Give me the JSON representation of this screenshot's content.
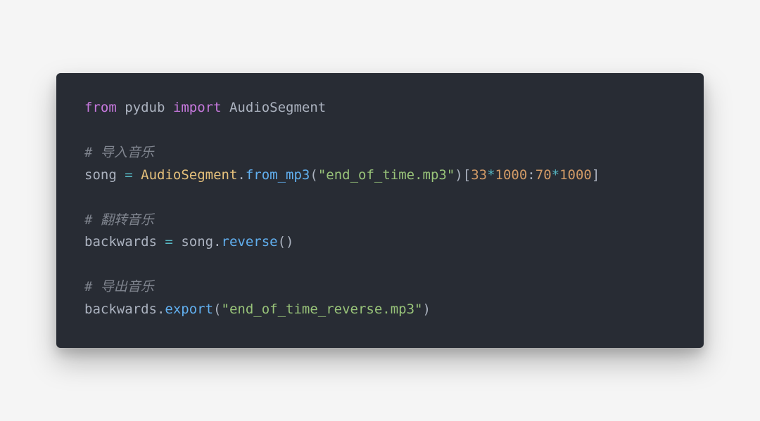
{
  "code": {
    "tokens": [
      [
        {
          "t": "from",
          "c": "kw"
        },
        {
          "t": " ",
          "c": "id"
        },
        {
          "t": "pydub",
          "c": "id"
        },
        {
          "t": " ",
          "c": "id"
        },
        {
          "t": "import",
          "c": "kw"
        },
        {
          "t": " ",
          "c": "id"
        },
        {
          "t": "AudioSegment",
          "c": "id"
        }
      ],
      [],
      [
        {
          "t": "# 导入音乐",
          "c": "cmt"
        }
      ],
      [
        {
          "t": "song",
          "c": "id"
        },
        {
          "t": " ",
          "c": "id"
        },
        {
          "t": "=",
          "c": "op"
        },
        {
          "t": " ",
          "c": "id"
        },
        {
          "t": "AudioSegment",
          "c": "cls"
        },
        {
          "t": ".",
          "c": "pun"
        },
        {
          "t": "from_mp3",
          "c": "fn"
        },
        {
          "t": "(",
          "c": "pun"
        },
        {
          "t": "\"end_of_time.mp3\"",
          "c": "str"
        },
        {
          "t": ")[",
          "c": "pun"
        },
        {
          "t": "33",
          "c": "num"
        },
        {
          "t": "*",
          "c": "op"
        },
        {
          "t": "1000",
          "c": "num"
        },
        {
          "t": ":",
          "c": "pun"
        },
        {
          "t": "70",
          "c": "num"
        },
        {
          "t": "*",
          "c": "op"
        },
        {
          "t": "1000",
          "c": "num"
        },
        {
          "t": "]",
          "c": "pun"
        }
      ],
      [],
      [
        {
          "t": "# 翻转音乐",
          "c": "cmt"
        }
      ],
      [
        {
          "t": "backwards",
          "c": "id"
        },
        {
          "t": " ",
          "c": "id"
        },
        {
          "t": "=",
          "c": "op"
        },
        {
          "t": " ",
          "c": "id"
        },
        {
          "t": "song",
          "c": "id"
        },
        {
          "t": ".",
          "c": "pun"
        },
        {
          "t": "reverse",
          "c": "fn"
        },
        {
          "t": "()",
          "c": "pun"
        }
      ],
      [],
      [
        {
          "t": "# 导出音乐",
          "c": "cmt"
        }
      ],
      [
        {
          "t": "backwards",
          "c": "id"
        },
        {
          "t": ".",
          "c": "pun"
        },
        {
          "t": "export",
          "c": "fn"
        },
        {
          "t": "(",
          "c": "pun"
        },
        {
          "t": "\"end_of_time_reverse.mp3\"",
          "c": "str"
        },
        {
          "t": ")",
          "c": "pun"
        }
      ]
    ]
  }
}
